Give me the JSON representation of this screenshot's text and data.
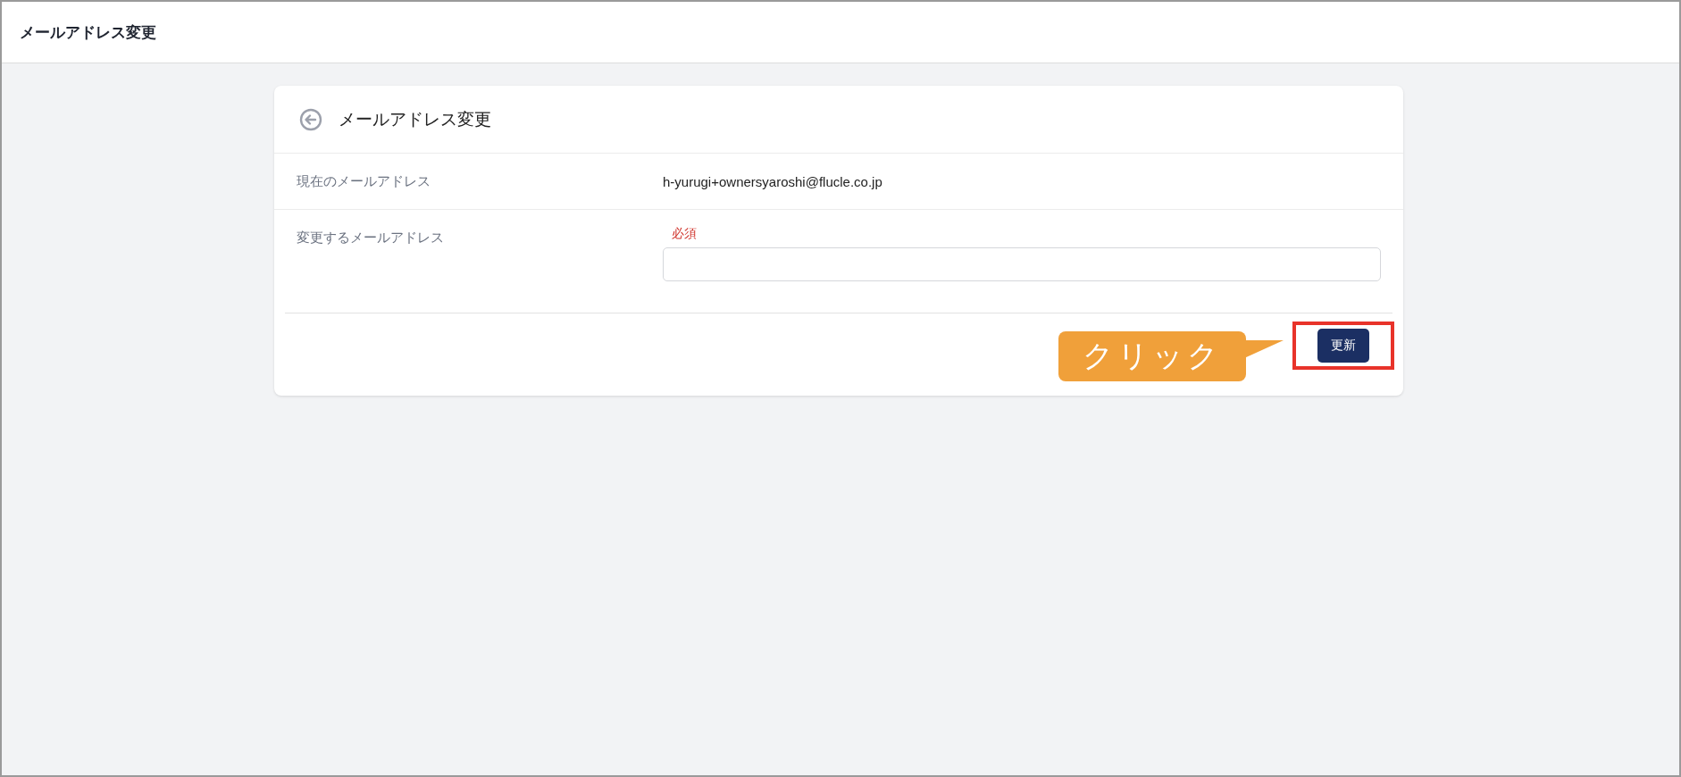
{
  "header": {
    "title": "メールアドレス変更"
  },
  "card": {
    "title": "メールアドレス変更",
    "rows": [
      {
        "kind": "text",
        "label": "現在のメールアドレス",
        "value": "h-yurugi+ownersyaroshi@flucle.co.jp"
      },
      {
        "kind": "input",
        "label": "変更するメールアドレス",
        "required": "必須"
      }
    ],
    "button": "更新"
  },
  "callout": {
    "text": "クリック"
  }
}
